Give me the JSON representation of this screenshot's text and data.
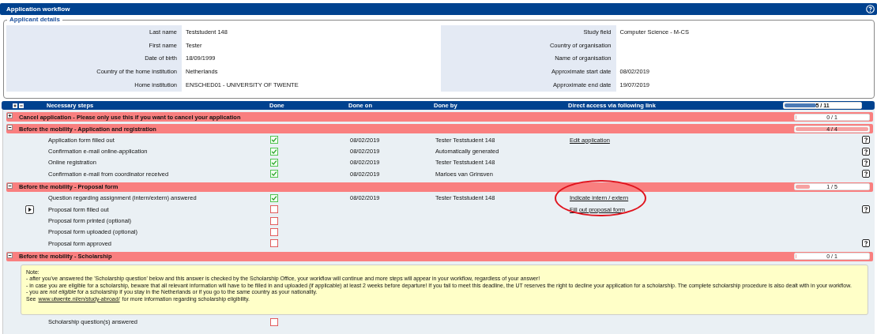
{
  "window": {
    "title": "Application workflow"
  },
  "applicant_details": {
    "title": "Applicant details",
    "left": [
      {
        "label": "Last name",
        "value": "Teststudent 148"
      },
      {
        "label": "First name",
        "value": "Tester"
      },
      {
        "label": "Date of birth",
        "value": "18/09/1999"
      },
      {
        "label": "Country of the home institution",
        "value": "Netherlands"
      },
      {
        "label": "Home institution",
        "value": "ENSCHED01 - UNIVERSITY OF TWENTE"
      }
    ],
    "right": [
      {
        "label": "Study field",
        "value": "Computer Science - M-CS"
      },
      {
        "label": "Country of organisation"
      },
      {
        "label": "Name of organisation"
      },
      {
        "label": "Approximate start date",
        "value": "08/02/2019"
      },
      {
        "label": "Approximate end date",
        "value": "19/07/2019"
      }
    ]
  },
  "steps_table": {
    "columns": [
      "Necessary steps",
      "Done",
      "Done on",
      "Done by",
      "Direct access via following link"
    ],
    "progress": {
      "text": "5 / 11",
      "level": 0.45
    },
    "groups": [
      {
        "title": "Cancel application - Please only use this if you want to cancel your application",
        "expanded": false,
        "progress": {
          "text": "0 / 1",
          "level": 0
        }
      },
      {
        "title": "Before the mobility - Application and registration",
        "expanded": true,
        "progress": {
          "text": "4 / 4",
          "level": 1
        },
        "steps": [
          {
            "name": "Application form filled out",
            "done": true,
            "done_on": "08/02/2019",
            "done_by": "Tester Teststudent 148",
            "link": "Edit application",
            "current": false,
            "help": true
          },
          {
            "name": "Confirmation e-mail online-application",
            "done": true,
            "done_on": "08/02/2019",
            "done_by": "Automatically generated",
            "current": false,
            "help": true
          },
          {
            "name": "Online registration",
            "done": true,
            "done_on": "08/02/2019",
            "done_by": "Tester Teststudent 148",
            "current": false,
            "help": true
          },
          {
            "name": "Confirmation e-mail from coordinator received",
            "done": true,
            "done_on": "08/02/2019",
            "done_by": "Marloes van Grinsven",
            "current": false,
            "help": true
          }
        ]
      },
      {
        "title": "Before the mobility - Proposal form",
        "expanded": true,
        "progress": {
          "text": "1 / 5",
          "level": 0.2
        },
        "steps": [
          {
            "name": "Question regarding assignment (intern/extern) answered",
            "done": true,
            "done_on": "08/02/2019",
            "done_by": "Tester Teststudent 148",
            "link": "Indicate intern / extern",
            "current": false,
            "help": false
          },
          {
            "name": "Proposal form filled out",
            "done": false,
            "link": "Fill out proposal form",
            "current": true,
            "help": true
          },
          {
            "name": "Proposal form printed (optional)",
            "done": false,
            "current": false,
            "help": false
          },
          {
            "name": "Proposal form uploaded (optional)",
            "done": false,
            "current": false,
            "help": false
          },
          {
            "name": "Proposal form approved",
            "done": false,
            "current": false,
            "help": true
          }
        ]
      },
      {
        "title": "Before the mobility - Scholarship",
        "expanded": true,
        "progress": {
          "text": "0 / 1",
          "level": 0
        },
        "note": {
          "title": "Note:",
          "lines": [
            "- after you've answered the 'Scholarship question' below and this answer is checked by the Scholarship Office, your workflow will continue and more steps will appear in your workflow, regardless of your answer!",
            "- in case you are eligible for a scholarship, beware that all relevant information will have to be filled in and uploaded (if applicable) at least 2 weeks before departure! If you fail to meet this deadline, the UT reserves the right to decline your application for a scholarship. The complete scholarship procedure is also dealt with in your workflow.",
            "- you are *not eligible* for a scholarship if you stay in the Netherlands or if you go to the same country as your nationality."
          ],
          "link_line": {
            "before": "See",
            "link": "www.utwente.nl/en/study-abroad/",
            "after": "for more information regarding scholarship eligibility."
          }
        },
        "steps": [
          {
            "name": "Scholarship question(s) answered",
            "done": false,
            "current": false,
            "help": false
          }
        ]
      }
    ]
  },
  "annotation": {
    "kind": "ellipse",
    "color": "#e0141e"
  }
}
